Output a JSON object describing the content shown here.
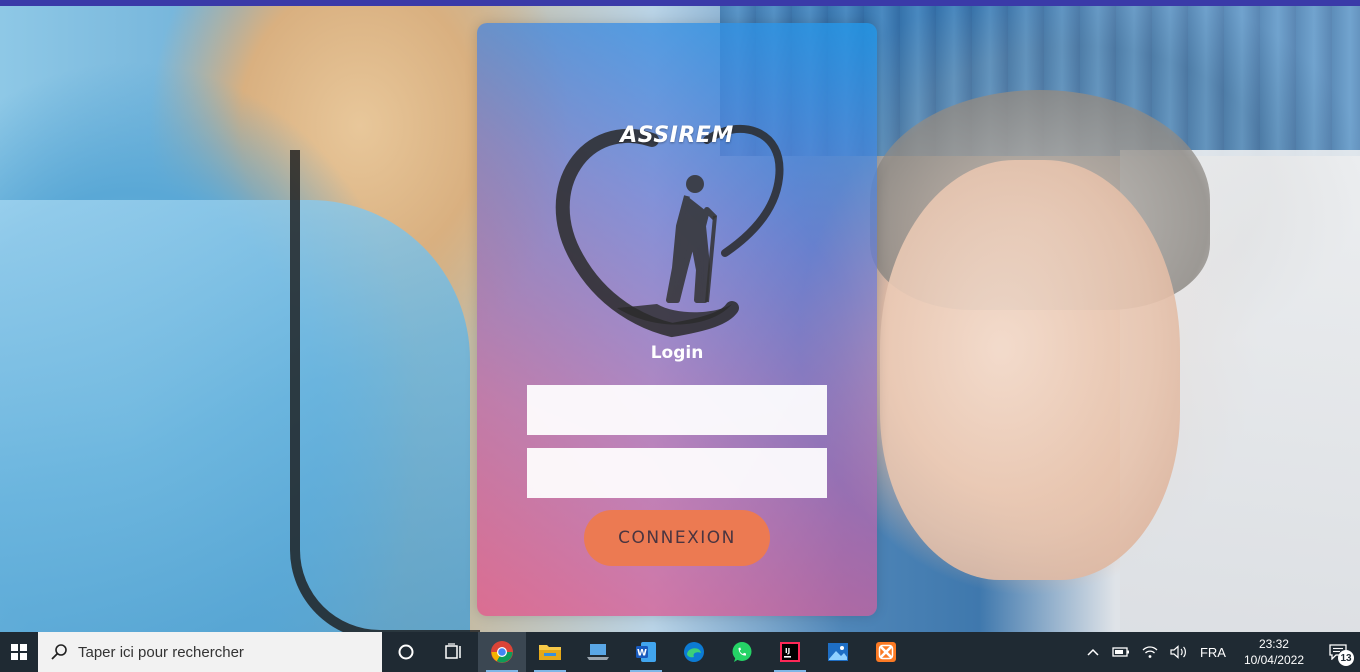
{
  "app": {
    "brand_name": "ASSIREM",
    "login_title": "Login",
    "username": {
      "value": "",
      "placeholder": ""
    },
    "password": {
      "value": "",
      "placeholder": ""
    },
    "submit_label": "CONNEXION",
    "colors": {
      "card_top": "#2096e6",
      "card_bottom": "#e15a8c",
      "button": "#ec7a52",
      "button_text": "#4a3540"
    }
  },
  "taskbar": {
    "search_placeholder": "Taper ici pour rechercher",
    "pinned": [
      {
        "name": "cortana",
        "icon": "circle-icon"
      },
      {
        "name": "task-view",
        "icon": "task-view-icon"
      },
      {
        "name": "chrome",
        "icon": "chrome-icon"
      },
      {
        "name": "file-explorer",
        "icon": "folder-icon"
      },
      {
        "name": "this-pc",
        "icon": "laptop-icon"
      },
      {
        "name": "word",
        "icon": "word-icon"
      },
      {
        "name": "edge",
        "icon": "edge-icon"
      },
      {
        "name": "whatsapp",
        "icon": "whatsapp-icon"
      },
      {
        "name": "intellij",
        "icon": "intellij-icon"
      },
      {
        "name": "photos",
        "icon": "photos-icon"
      },
      {
        "name": "xampp",
        "icon": "xampp-icon"
      }
    ],
    "tray": {
      "language": "FRA",
      "time": "23:32",
      "date": "10/04/2022",
      "notification_count": "13"
    }
  }
}
